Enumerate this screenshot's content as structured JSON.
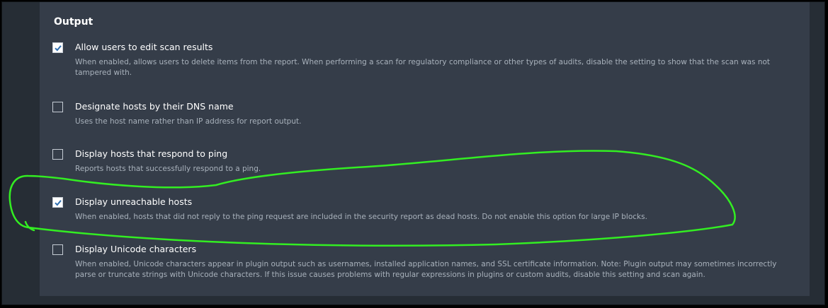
{
  "section": {
    "title": "Output"
  },
  "options": [
    {
      "label": "Allow users to edit scan results",
      "description": "When enabled, allows users to delete items from the report. When performing a scan for regulatory compliance or other types of audits, disable the setting to show that the scan was not tampered with.",
      "checked": true
    },
    {
      "label": "Designate hosts by their DNS name",
      "description": "Uses the host name rather than IP address for report output.",
      "checked": false
    },
    {
      "label": "Display hosts that respond to ping",
      "description": "Reports hosts that successfully respond to a ping.",
      "checked": false
    },
    {
      "label": "Display unreachable hosts",
      "description": "When enabled, hosts that did not reply to the ping request are included in the security report as dead hosts. Do not enable this option for large IP blocks.",
      "checked": true
    },
    {
      "label": "Display Unicode characters",
      "description": "When enabled, Unicode characters appear in plugin output such as usernames, installed application names, and SSL certificate information. Note: Plugin output may sometimes incorrectly parse or truncate strings with Unicode characters. If this issue causes problems with regular expressions in plugins or custom audits, disable this setting and scan again.",
      "checked": false
    }
  ],
  "colors": {
    "background": "#262d35",
    "panel": "#353d49",
    "label": "#ffffff",
    "description": "#a9b2bc",
    "check_mark": "#2f6fb0",
    "annotation_stroke": "#33ee22"
  }
}
